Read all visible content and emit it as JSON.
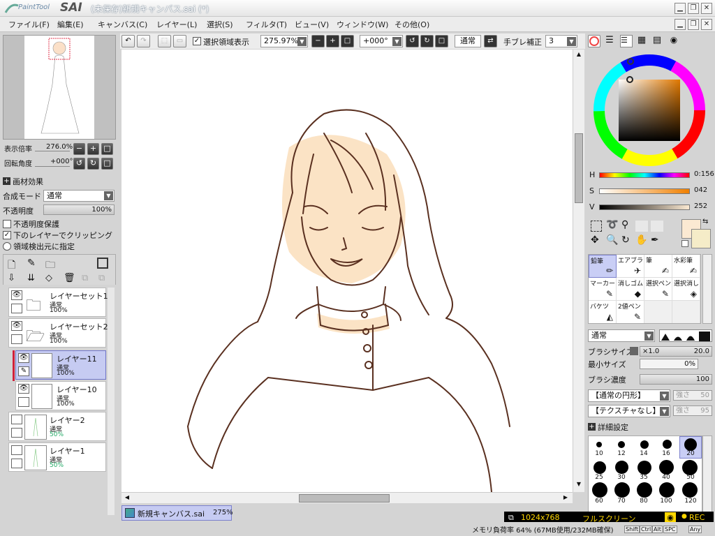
{
  "window": {
    "logo_small": "PaintTool",
    "logo_big": "SAI",
    "title": "(未保存)新規キャンバス.sai (*)"
  },
  "menu": [
    "ファイル(F)",
    "編集(E)",
    "キャンバス(C)",
    "レイヤー(L)",
    "選択(S)",
    "フィルタ(T)",
    "ビュー(V)",
    "ウィンドウ(W)",
    "その他(O)"
  ],
  "navigator": {
    "zoom_label": "表示倍率",
    "zoom_value": "276.0%",
    "rotate_label": "回転角度",
    "rotate_value": "+000°"
  },
  "layer_props": {
    "texture_label": "画材効果",
    "blend_label": "合成モード",
    "blend_value": "通常",
    "opacity_label": "不透明度",
    "opacity_value": "100%",
    "opacity_fraction": 1.0,
    "preserve_opacity": "不透明度保護",
    "preserve_opacity_checked": false,
    "clipping": "下のレイヤーでクリッピング",
    "clipping_checked": true,
    "selection_source": "領域検出元に指定",
    "selection_source_checked": false
  },
  "layers": [
    {
      "name": "レイヤーセット1",
      "mode": "通常",
      "opacity": "100%",
      "type": "folder",
      "visible": true,
      "selected": false
    },
    {
      "name": "レイヤーセット2",
      "mode": "通常",
      "opacity": "100%",
      "type": "folder",
      "visible": true,
      "selected": false
    },
    {
      "name": "レイヤー11",
      "mode": "通常",
      "opacity": "100%",
      "type": "layer",
      "visible": true,
      "selected": true
    },
    {
      "name": "レイヤー10",
      "mode": "通常",
      "opacity": "100%",
      "type": "layer",
      "visible": true,
      "selected": false
    },
    {
      "name": "レイヤー2",
      "mode": "通常",
      "opacity": "50%",
      "type": "layer",
      "visible": false,
      "selected": false
    },
    {
      "name": "レイヤー1",
      "mode": "通常",
      "opacity": "50%",
      "type": "layer",
      "visible": false,
      "selected": false
    }
  ],
  "toolbar": {
    "selection_display": "選択領域表示",
    "selection_display_checked": true,
    "zoom": "275.97%",
    "angle": "+000°",
    "mode": "通常",
    "stabilizer_label": "手ブレ補正",
    "stabilizer_value": "3"
  },
  "color": {
    "h_label": "H",
    "h_value": "0:156",
    "s_label": "S",
    "s_value": "042",
    "v_label": "V",
    "v_value": "252",
    "primary": "#fbe9d2",
    "secondary": "#f5ecc8"
  },
  "tools": [
    {
      "name": "鉛筆",
      "selected": true
    },
    {
      "name": "エアブラシ",
      "selected": false
    },
    {
      "name": "筆",
      "selected": false
    },
    {
      "name": "水彩筆",
      "selected": false
    },
    {
      "name": "マーカー",
      "selected": false
    },
    {
      "name": "消しゴム",
      "selected": false
    },
    {
      "name": "選択ペン",
      "selected": false
    },
    {
      "name": "選択消し",
      "selected": false
    },
    {
      "name": "バケツ",
      "selected": false
    },
    {
      "name": "2値ペン",
      "selected": false
    }
  ],
  "brush": {
    "mode": "通常",
    "size_label": "ブラシサイズ",
    "size_mult": "×1.0",
    "size_value": "20.0",
    "min_label": "最小サイズ",
    "min_value": "0%",
    "density_label": "ブラシ濃度",
    "density_value": "100",
    "shape": "【通常の円形】",
    "shape_strength_label": "強さ",
    "shape_strength": "50",
    "texture": "【テクスチャなし】",
    "texture_strength_label": "強さ",
    "texture_strength": "95",
    "detail_label": "詳細設定",
    "sizes": [
      "10",
      "12",
      "14",
      "16",
      "20",
      "25",
      "30",
      "35",
      "40",
      "50",
      "60",
      "70",
      "80",
      "100",
      "120"
    ],
    "selected_size": "20"
  },
  "tab": {
    "name": "新規キャンバス.sai",
    "zoom": "275%"
  },
  "recorder": {
    "size": "1024x768",
    "mode": "フルスクリーン",
    "rec": "REC"
  },
  "status": {
    "memory": "メモリ負荷率 64% (67MB使用/232MB確保)",
    "keys": [
      "Shift",
      "Ctrl",
      "Alt",
      "SPC",
      "Any"
    ]
  }
}
